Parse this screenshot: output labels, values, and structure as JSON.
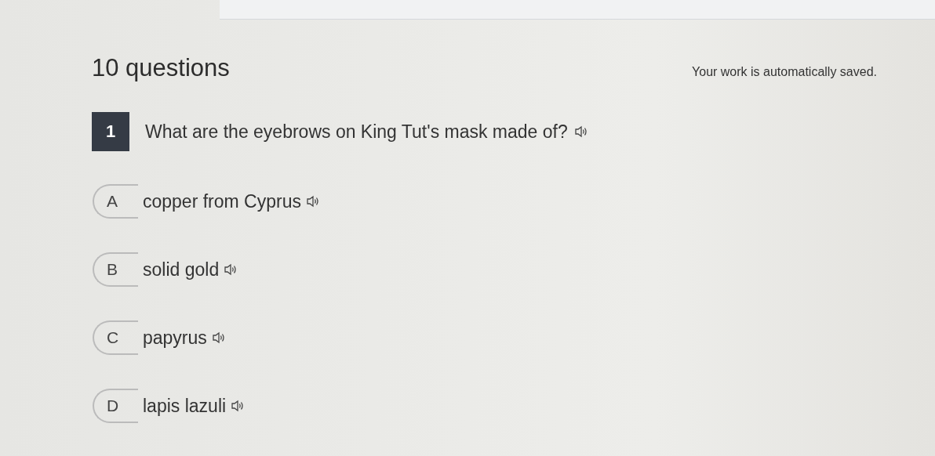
{
  "header": {
    "count": "10 questions",
    "save_note": "Your work is automatically saved."
  },
  "question": {
    "number": "1",
    "text": "What are the eyebrows on King Tut's mask made of?",
    "options": [
      {
        "letter": "A",
        "text": "copper from Cyprus",
        "selected": false
      },
      {
        "letter": "B",
        "text": "solid gold",
        "selected": false
      },
      {
        "letter": "C",
        "text": "papyrus",
        "selected": false
      },
      {
        "letter": "D",
        "text": "lapis lazuli",
        "selected": false
      }
    ]
  }
}
